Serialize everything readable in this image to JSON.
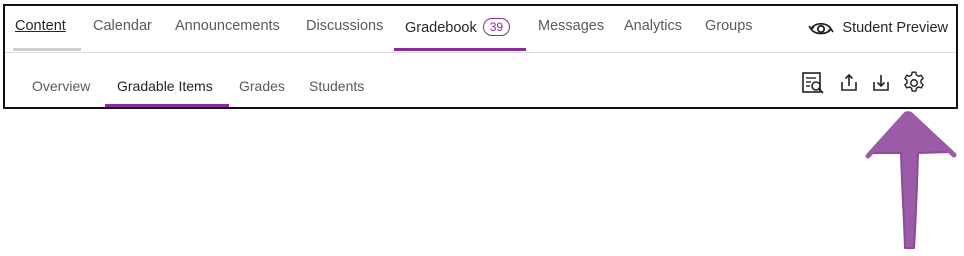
{
  "colors": {
    "accent": "#8a2c9a",
    "arrow": "#9b5ba6",
    "inactive_underline": "#d0d0d0"
  },
  "top_nav": {
    "items": [
      {
        "label": "Content",
        "state": "current-page"
      },
      {
        "label": "Calendar"
      },
      {
        "label": "Announcements"
      },
      {
        "label": "Discussions"
      },
      {
        "label": "Gradebook",
        "badge": "39",
        "state": "selected"
      },
      {
        "label": "Messages"
      },
      {
        "label": "Analytics"
      },
      {
        "label": "Groups"
      }
    ],
    "student_preview": {
      "label": "Student Preview",
      "icon": "eye-refresh-icon"
    }
  },
  "sub_nav": {
    "items": [
      {
        "label": "Overview"
      },
      {
        "label": "Gradable Items",
        "state": "selected"
      },
      {
        "label": "Grades"
      },
      {
        "label": "Students"
      }
    ],
    "tools": [
      {
        "icon": "search-list-icon"
      },
      {
        "icon": "upload-icon"
      },
      {
        "icon": "download-icon"
      },
      {
        "icon": "gear-icon"
      }
    ]
  },
  "annotation": {
    "icon": "arrow-up-icon",
    "points_to": "gear-icon"
  }
}
